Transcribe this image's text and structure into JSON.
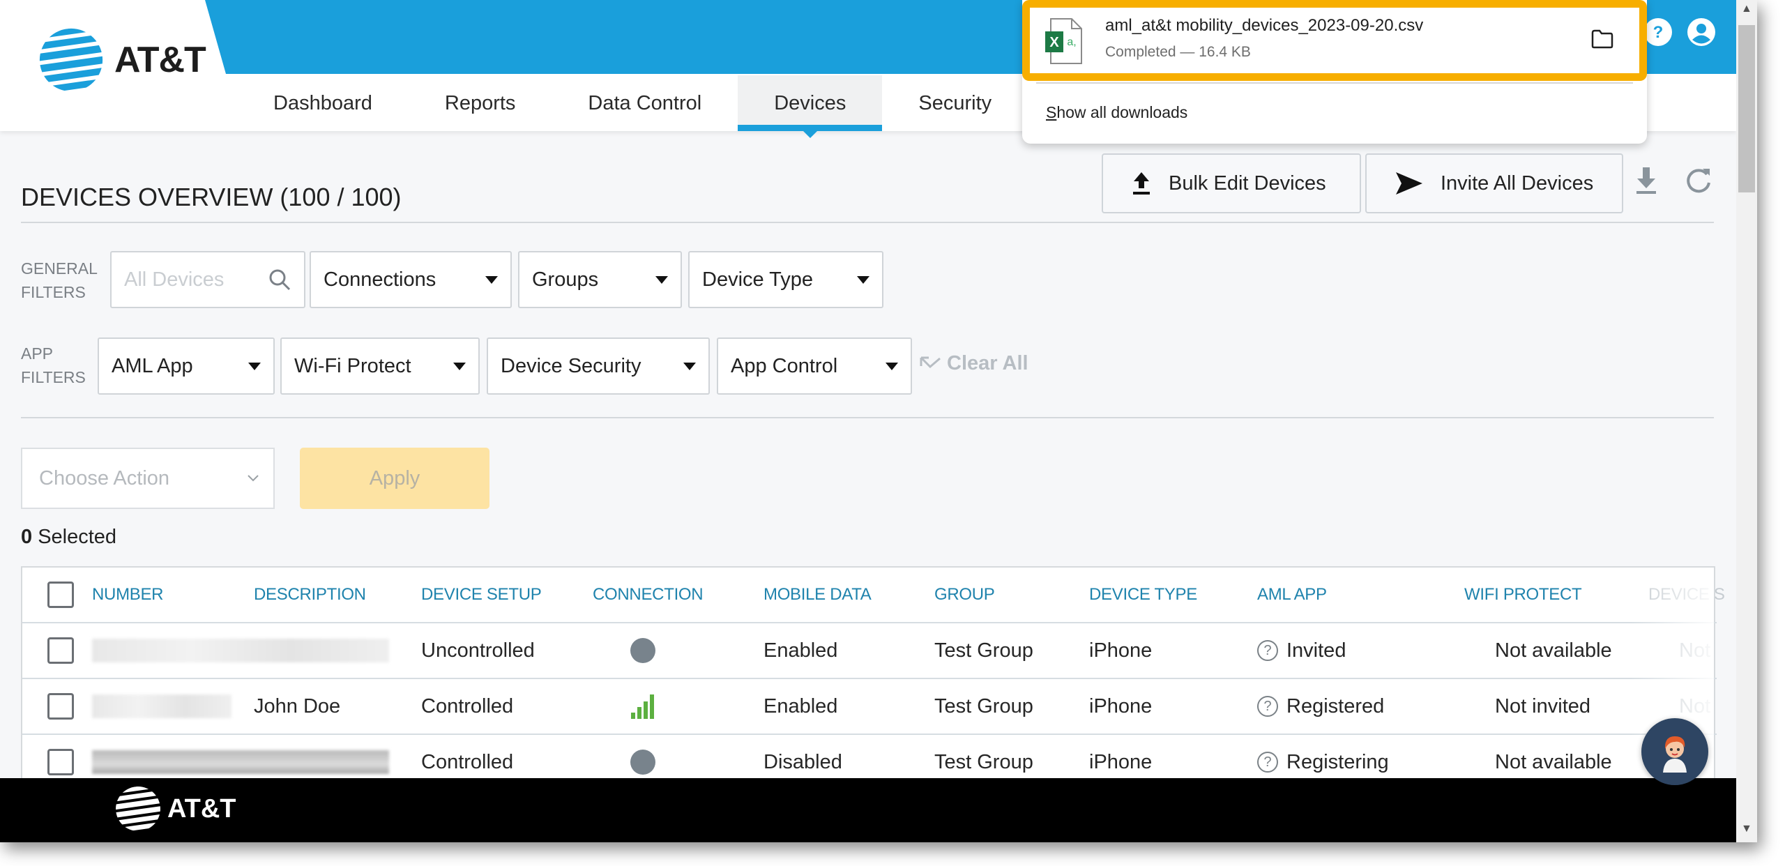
{
  "header": {
    "brand": "AT&T",
    "nav": [
      {
        "label": "Dashboard",
        "active": false
      },
      {
        "label": "Reports",
        "active": false
      },
      {
        "label": "Data Control",
        "active": false
      },
      {
        "label": "Devices",
        "active": true
      },
      {
        "label": "Security",
        "active": false
      }
    ],
    "icons": [
      "help-icon",
      "user-profile-icon"
    ]
  },
  "downloads": {
    "file_name": "aml_at&t mobility_devices_2023-09-20.csv",
    "status": "Completed — 16.4 KB",
    "file_icon": "excel-csv-file-icon",
    "folder_icon": "folder-icon",
    "show_all_first": "S",
    "show_all_rest": "how all downloads"
  },
  "page": {
    "title": "DEVICES OVERVIEW (100 / 100)",
    "buttons": {
      "bulk_edit": "Bulk Edit Devices",
      "invite_all": "Invite All Devices"
    },
    "tool_icons": [
      "download-icon",
      "refresh-icon"
    ]
  },
  "filters": {
    "general_label_1": "GENERAL",
    "general_label_2": "FILTERS",
    "search_placeholder": "All Devices",
    "general": [
      "Connections",
      "Groups",
      "Device Type"
    ],
    "app_label_1": "APP",
    "app_label_2": "FILTERS",
    "app": [
      "AML App",
      "Wi-Fi Protect",
      "Device Security",
      "App Control"
    ],
    "clear_all": "Clear All"
  },
  "actions": {
    "choose_placeholder": "Choose Action",
    "apply": "Apply",
    "selected_count": "0",
    "selected_label": " Selected"
  },
  "table": {
    "columns": [
      "NUMBER",
      "DESCRIPTION",
      "DEVICE SETUP",
      "CONNECTION",
      "MOBILE DATA",
      "GROUP",
      "DEVICE TYPE",
      "AML APP",
      "WIFI PROTECT",
      "DEVICE S"
    ],
    "rows": [
      {
        "number": "",
        "description": "",
        "device_setup": "Uncontrolled",
        "connection": "offline",
        "mobile_data": "Enabled",
        "group": "Test Group",
        "device_type": "iPhone",
        "aml_app": "Invited",
        "wifi_protect": "Not available",
        "device_security": "Not"
      },
      {
        "number": "",
        "description": "John Doe",
        "device_setup": "Controlled",
        "connection": "signal",
        "mobile_data": "Enabled",
        "group": "Test Group",
        "device_type": "iPhone",
        "aml_app": "Registered",
        "wifi_protect": "Not invited",
        "device_security": "Not"
      },
      {
        "number": "",
        "description": "",
        "device_setup": "Controlled",
        "connection": "offline",
        "mobile_data": "Disabled",
        "group": "Test Group",
        "device_type": "iPhone",
        "aml_app": "Registering",
        "wifi_protect": "Not available",
        "device_security": ""
      }
    ]
  },
  "footer": {
    "brand": "AT&T"
  },
  "colors": {
    "brand_blue": "#1a9fdb",
    "highlight": "#f7ae00",
    "apply_disabled": "#fde3a3",
    "header_text": "#1f83ad",
    "signal_green": "#5cb040"
  }
}
